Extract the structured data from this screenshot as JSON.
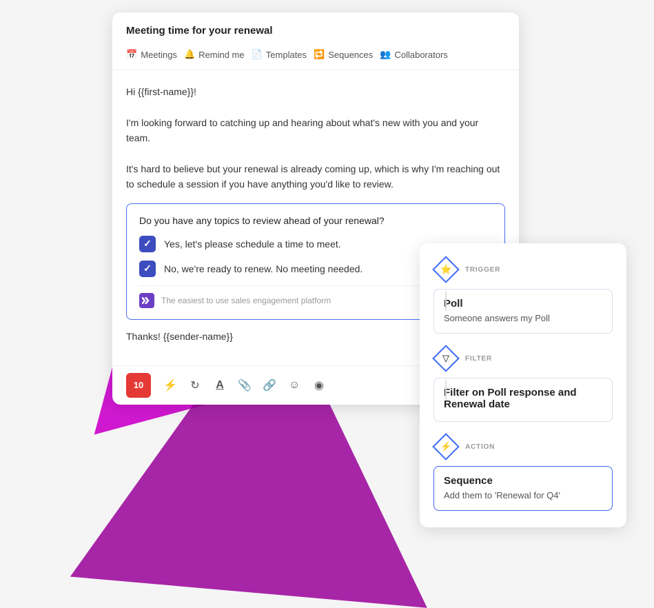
{
  "background": {
    "triangle1": "purple bg shape 1",
    "triangle2": "purple bg shape 2"
  },
  "email": {
    "subject": "Meeting time for your renewal",
    "nav": {
      "meetings": "Meetings",
      "remind_me": "Remind me",
      "templates": "Templates",
      "sequences": "Sequences",
      "collaborators": "Collaborators"
    },
    "body": {
      "line1": "Hi {{first-name}}!",
      "line2": "I'm looking forward to catching up and hearing about what's new with you and your team.",
      "line3": "It's hard to believe but your renewal is already coming up, which is why I'm reaching out to schedule a session if you have anything you'd like to review."
    },
    "poll": {
      "question": "Do you have any topics to review ahead of your renewal?",
      "option1": "Yes, let's please schedule a time to meet.",
      "option2": "No, we're ready to renew. No meeting needed.",
      "footer_text": "The easiest to use sales engagement platform"
    },
    "thanks": "Thanks! {{sender-name}}",
    "toolbar": {
      "red_btn": "10",
      "icon_lightning": "⚡",
      "icon_refresh": "↻",
      "icon_text": "A",
      "icon_attach": "📎",
      "icon_link": "🔗",
      "icon_emoji": "☺",
      "icon_more": "◎"
    }
  },
  "workflow": {
    "trigger": {
      "tag": "TRIGGER",
      "title": "Poll",
      "description": "Someone answers my Poll"
    },
    "filter": {
      "tag": "FILTER",
      "title": "Filter on Poll response and Renewal date",
      "description": ""
    },
    "action": {
      "tag": "ACTION",
      "title": "Sequence",
      "description": "Add them to 'Renewal for Q4'"
    }
  }
}
